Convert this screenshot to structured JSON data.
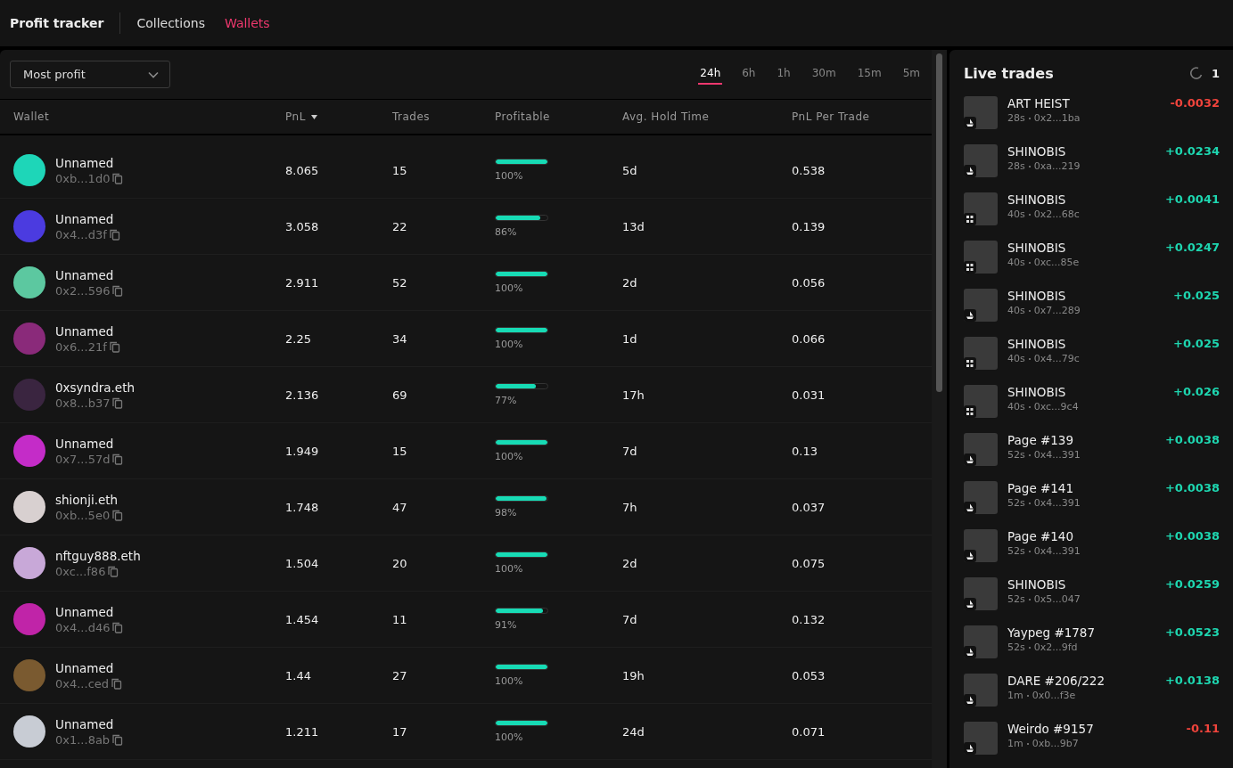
{
  "nav": {
    "title": "Profit tracker",
    "tabs": [
      {
        "label": "Collections",
        "selected": false
      },
      {
        "label": "Wallets",
        "selected": true
      }
    ]
  },
  "filter": {
    "value": "Most profit"
  },
  "periods": [
    {
      "label": "24h",
      "selected": true
    },
    {
      "label": "6h",
      "selected": false
    },
    {
      "label": "1h",
      "selected": false
    },
    {
      "label": "30m",
      "selected": false
    },
    {
      "label": "15m",
      "selected": false
    },
    {
      "label": "5m",
      "selected": false
    }
  ],
  "table": {
    "columns": [
      {
        "label": "Wallet",
        "sorted": false
      },
      {
        "label": "PnL",
        "sorted": true
      },
      {
        "label": "Trades",
        "sorted": false
      },
      {
        "label": "Profitable",
        "sorted": false
      },
      {
        "label": "Avg. Hold Time",
        "sorted": false
      },
      {
        "label": "PnL Per Trade",
        "sorted": false
      }
    ],
    "rows": [
      {
        "name": "Unnamed",
        "address": "0xb...1d0",
        "color": "#1ed6b8",
        "pnl": "8.065",
        "trades": "15",
        "level": 1.0,
        "profitable": "100%",
        "hold": "5d",
        "per_trade": "0.538"
      },
      {
        "name": "Unnamed",
        "address": "0x4...d3f",
        "color": "#4b3be0",
        "pnl": "3.058",
        "trades": "22",
        "level": 0.86,
        "profitable": "86%",
        "hold": "13d",
        "per_trade": "0.139"
      },
      {
        "name": "Unnamed",
        "address": "0x2...596",
        "color": "#5cc8a0",
        "pnl": "2.911",
        "trades": "52",
        "level": 1.0,
        "profitable": "100%",
        "hold": "2d",
        "per_trade": "0.056"
      },
      {
        "name": "Unnamed",
        "address": "0x6...21f",
        "color": "#8a2a7a",
        "pnl": "2.25",
        "trades": "34",
        "level": 1.0,
        "profitable": "100%",
        "hold": "1d",
        "per_trade": "0.066"
      },
      {
        "name": "0xsyndra.eth",
        "address": "0x8...b37",
        "color": "#3a2540",
        "pnl": "2.136",
        "trades": "69",
        "level": 0.77,
        "profitable": "77%",
        "hold": "17h",
        "per_trade": "0.031"
      },
      {
        "name": "Unnamed",
        "address": "0x7...57d",
        "color": "#c42cc8",
        "pnl": "1.949",
        "trades": "15",
        "level": 1.0,
        "profitable": "100%",
        "hold": "7d",
        "per_trade": "0.13"
      },
      {
        "name": "shionji.eth",
        "address": "0xb...5e0",
        "color": "#d8d0d0",
        "pnl": "1.748",
        "trades": "47",
        "level": 0.98,
        "profitable": "98%",
        "hold": "7h",
        "per_trade": "0.037"
      },
      {
        "name": "nftguy888.eth",
        "address": "0xc...f86",
        "color": "#c8a8d8",
        "pnl": "1.504",
        "trades": "20",
        "level": 1.0,
        "profitable": "100%",
        "hold": "2d",
        "per_trade": "0.075"
      },
      {
        "name": "Unnamed",
        "address": "0x4...d46",
        "color": "#c024a8",
        "pnl": "1.454",
        "trades": "11",
        "level": 0.91,
        "profitable": "91%",
        "hold": "7d",
        "per_trade": "0.132"
      },
      {
        "name": "Unnamed",
        "address": "0x4...ced",
        "color": "#7a5a30",
        "pnl": "1.44",
        "trades": "27",
        "level": 1.0,
        "profitable": "100%",
        "hold": "19h",
        "per_trade": "0.053"
      },
      {
        "name": "Unnamed",
        "address": "0x1...8ab",
        "color": "#c8ccd4",
        "pnl": "1.211",
        "trades": "17",
        "level": 1.0,
        "profitable": "100%",
        "hold": "24d",
        "per_trade": "0.071"
      }
    ]
  },
  "live": {
    "title": "Live trades",
    "count": "1",
    "trades": [
      {
        "name": "ART HEIST",
        "time": "28s",
        "address": "0x2...1ba",
        "change": "-0.0032",
        "color": "#f0443c",
        "kind": "ship"
      },
      {
        "name": "SHINOBIS",
        "time": "28s",
        "address": "0xa...219",
        "change": "+0.0234",
        "color": "#1ed6b0",
        "kind": "ship"
      },
      {
        "name": "SHINOBIS",
        "time": "40s",
        "address": "0x2...68c",
        "change": "+0.0041",
        "color": "#1ed6b0",
        "kind": "blocks"
      },
      {
        "name": "SHINOBIS",
        "time": "40s",
        "address": "0xc...85e",
        "change": "+0.0247",
        "color": "#1ed6b0",
        "kind": "blocks"
      },
      {
        "name": "SHINOBIS",
        "time": "40s",
        "address": "0x7...289",
        "change": "+0.025",
        "color": "#1ed6b0",
        "kind": "ship"
      },
      {
        "name": "SHINOBIS",
        "time": "40s",
        "address": "0x4...79c",
        "change": "+0.025",
        "color": "#1ed6b0",
        "kind": "blocks"
      },
      {
        "name": "SHINOBIS",
        "time": "40s",
        "address": "0xc...9c4",
        "change": "+0.026",
        "color": "#1ed6b0",
        "kind": "blocks"
      },
      {
        "name": "Page #139",
        "time": "52s",
        "address": "0x4...391",
        "change": "+0.0038",
        "color": "#1ed6b0",
        "kind": "ship"
      },
      {
        "name": "Page #141",
        "time": "52s",
        "address": "0x4...391",
        "change": "+0.0038",
        "color": "#1ed6b0",
        "kind": "ship"
      },
      {
        "name": "Page #140",
        "time": "52s",
        "address": "0x4...391",
        "change": "+0.0038",
        "color": "#1ed6b0",
        "kind": "ship"
      },
      {
        "name": "SHINOBIS",
        "time": "52s",
        "address": "0x5...047",
        "change": "+0.0259",
        "color": "#1ed6b0",
        "kind": "ship"
      },
      {
        "name": "Yaypeg #1787",
        "time": "52s",
        "address": "0x2...9fd",
        "change": "+0.0523",
        "color": "#1ed6b0",
        "kind": "ship"
      },
      {
        "name": "DARE #206/222",
        "time": "1m",
        "address": "0x0...f3e",
        "change": "+0.0138",
        "color": "#1ed6b0",
        "kind": "ship"
      },
      {
        "name": "Weirdo #9157",
        "time": "1m",
        "address": "0xb...9b7",
        "change": "-0.11",
        "color": "#f0443c",
        "kind": "ship"
      }
    ]
  }
}
